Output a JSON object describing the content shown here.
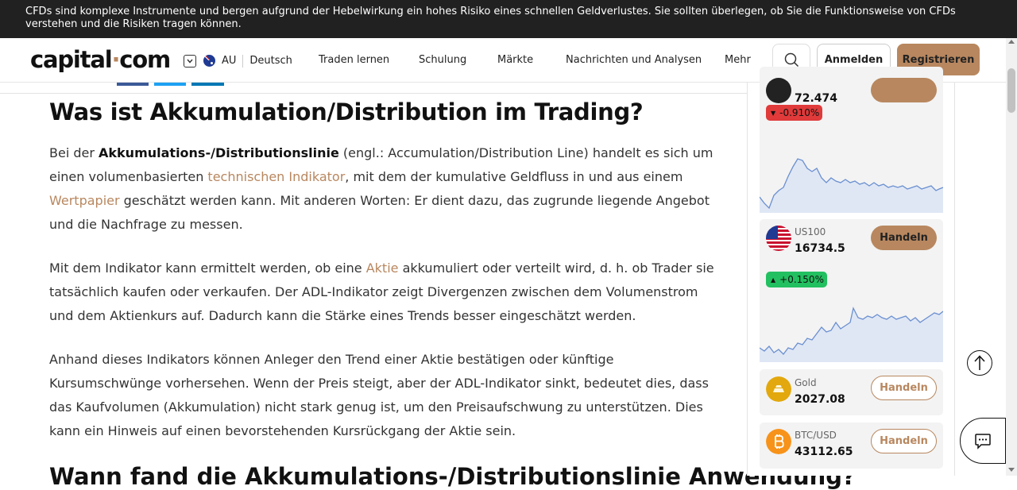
{
  "risk_banner": {
    "text": "CFDs sind komplexe Instrumente und bergen aufgrund der Hebelwirkung ein hohes Risiko eines schnellen Geldverlustes. Sie sollten überlegen, ob Sie die Funktionsweise von CFDs verstehen und die Risiken tragen können."
  },
  "header": {
    "logo_main": "capital",
    "logo_dot": "·",
    "logo_tail": "com",
    "region": "AU",
    "language": "Deutsch",
    "nav": [
      "Traden lernen",
      "Schulung",
      "Märkte",
      "Nachrichten und Analysen",
      "Mehr"
    ],
    "login_label": "Anmelden",
    "register_label": "Registrieren"
  },
  "article": {
    "heading": "Was ist Akkumulation/Distribution im Trading?",
    "p1": {
      "t1": "Bei der ",
      "b1": "Akkumulations-/Distributionslinie",
      "t2": " (engl.: Accumulation/Distribution Line) handelt es sich um einen volumenbasierten ",
      "link1": "technischen Indikator",
      "t3": ", mit dem der kumulative Geldfluss in und aus einem ",
      "link2": "Wertpapier",
      "t4": " geschätzt werden kann. Mit anderen Worten: Er dient dazu, das zugrunde liegende Angebot und die Nachfrage zu messen."
    },
    "p2": {
      "t1": "Mit dem Indikator kann ermittelt werden, ob eine ",
      "link1": "Aktie",
      "t2": " akkumuliert oder verteilt wird, d. h. ob Trader sie tatsächlich kaufen oder verkaufen. Der ADL-Indikator zeigt Divergenzen zwischen dem Volumenstrom und dem Aktienkurs auf. Dadurch kann die Stärke eines Trends besser eingeschätzt werden."
    },
    "p3": "Anhand dieses Indikators können Anleger den Trend einer Aktie bestätigen oder künftige Kursumschwünge vorhersehen. Wenn der Preis steigt, aber der ADL-Indikator sinkt, bedeutet dies, dass das Kaufvolumen (Akkumulation) nicht stark genug ist, um den Preisaufschwung zu unterstützen. Dies kann ein Hinweis auf einen bevorstehenden Kursrückgang der Aktie sein.",
    "next_heading": "Wann fand die Akkumulations-/Distributionslinie Anwendung?"
  },
  "sidebar": {
    "cards": [
      {
        "symbol": "",
        "price": "72.474",
        "change": "-0.910%",
        "direction": "down",
        "trade_label": ""
      },
      {
        "symbol": "US100",
        "price": "16734.5",
        "change": "+0.150%",
        "direction": "up",
        "trade_label": "Handeln",
        "icon": "us-flag-icon"
      },
      {
        "symbol": "Gold",
        "price": "2027.08",
        "trade_label": "Handeln",
        "icon": "gold-bars-icon"
      },
      {
        "symbol": "BTC/USD",
        "price": "43112.65",
        "trade_label": "Handeln",
        "icon": "bitcoin-icon"
      }
    ]
  },
  "colors": {
    "accent": "#b8875f",
    "banner_bg": "#212121",
    "down": "#e03a3a",
    "up": "#22c060",
    "spark_line": "#6a8fd0"
  }
}
